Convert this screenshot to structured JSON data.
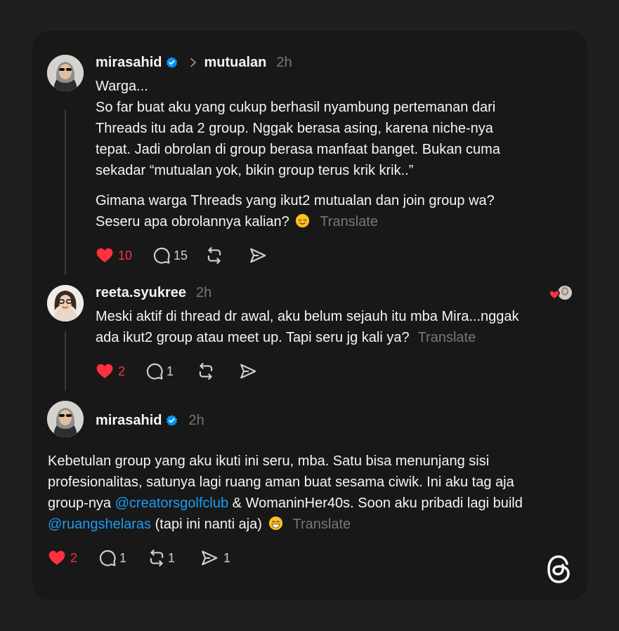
{
  "colors": {
    "background": "#1f1f1f",
    "card": "#181818",
    "text": "#f3f5f7",
    "muted": "#777777",
    "like": "#ff3040",
    "link": "#1d9bf0",
    "verified": "#0095f6"
  },
  "post1": {
    "username": "mirasahid",
    "verified": true,
    "context": "mutualan",
    "time": "2h",
    "lines": [
      "Warga...",
      "So far buat aku yang cukup berhasil nyambung pertemanan dari",
      "Threads itu ada 2 group. Nggak berasa asing, karena niche-nya",
      "tepat. Jadi obrolan di group berasa manfaat banget. Bukan cuma",
      "sekadar “mutualan yok, bikin group terus krik krik..”"
    ],
    "para2_line1": "Gimana warga Threads yang ikut2 mutualan dan join group wa?",
    "para2_line2": "Seseru apa obrolannya kalian?",
    "emoji": "relieved-face",
    "translate": "Translate",
    "likes": "10",
    "replies": "15"
  },
  "post2": {
    "username": "reeta.syukree",
    "time": "2h",
    "line1": "Meski aktif di thread dr awal, aku belum sejauh itu mba Mira...nggak",
    "line2": "ada ikut2 group atau meet up. Tapi seru jg kali ya?",
    "translate": "Translate",
    "likes": "2",
    "replies": "1"
  },
  "post3": {
    "username": "mirasahid",
    "verified": true,
    "time": "2h",
    "line1": "Kebetulan group yang aku ikuti ini seru, mba. Satu bisa menunjang sisi",
    "line2": "profesionalitas, satunya lagi ruang aman buat sesama ciwik. Ini aku tag aja",
    "line3_pre": "group-nya ",
    "mention1": "@creatorsgolfclub",
    "line3_post": " & WomaninHer40s. Soon aku pribadi lagi build",
    "mention2": "@ruangshelaras",
    "line4_post": " (tapi ini nanti aja)",
    "emoji": "grinning-sweat-face",
    "translate": "Translate",
    "likes": "2",
    "replies": "1",
    "reposts": "1",
    "shares": "1"
  },
  "icons": [
    "verified-badge-icon",
    "chevron-right-icon",
    "heart-icon",
    "comment-icon",
    "repost-icon",
    "share-icon",
    "threads-logo-icon"
  ]
}
